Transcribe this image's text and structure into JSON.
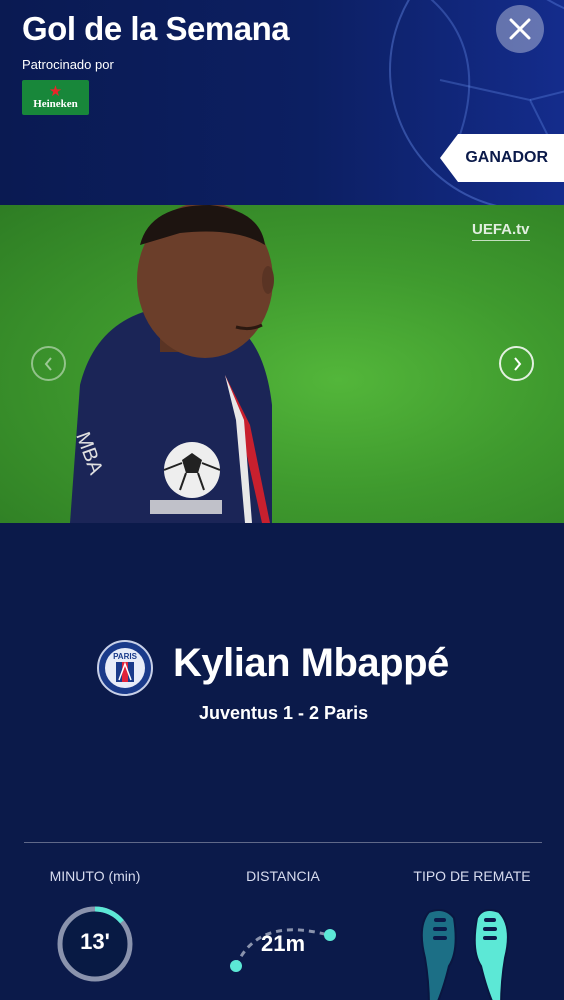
{
  "header": {
    "title": "Gol de la Semana",
    "sponsor_label": "Patrocinado por",
    "sponsor_brand": "Heineken",
    "winner_label": "GANADOR",
    "close_icon": "close-icon"
  },
  "video": {
    "watermark": "UEFA.tv",
    "prev_icon": "chevron-left-icon",
    "next_icon": "chevron-right-icon"
  },
  "goal": {
    "club_badge_text": "PARIS",
    "player_name": "Kylian Mbappé",
    "match": "Juventus 1 - 2 Paris"
  },
  "stats": {
    "minute": {
      "label": "MINUTO (min)",
      "value": "13'",
      "progress_fraction": 0.14
    },
    "distance": {
      "label": "DISTANCIA",
      "value": "21m"
    },
    "shot_type": {
      "label": "TIPO DE REMATE",
      "active_foot": "right"
    }
  },
  "colors": {
    "background": "#0b1a4a",
    "accent": "#5ce8d6",
    "sponsor_green": "#18873a"
  }
}
